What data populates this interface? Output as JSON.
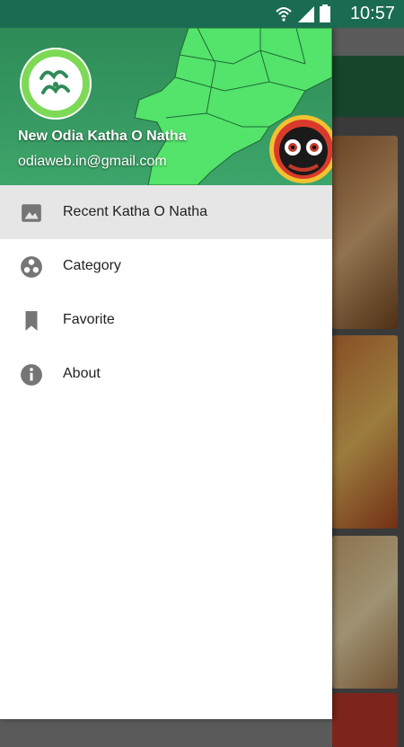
{
  "status_bar": {
    "time": "10:57"
  },
  "drawer": {
    "title": "New Odia Katha O Natha",
    "email": "odiaweb.in@gmail.com",
    "menu": [
      {
        "label": "Recent Katha O Natha",
        "icon": "image-icon",
        "active": true
      },
      {
        "label": "Category",
        "icon": "category-icon",
        "active": false
      },
      {
        "label": "Favorite",
        "icon": "bookmark-icon",
        "active": false
      },
      {
        "label": "About",
        "icon": "info-icon",
        "active": false
      }
    ]
  },
  "colors": {
    "status_bar": "#1b6b52",
    "header_green": "#2e8b57",
    "map_green": "#54e36b",
    "active_item": "#e6e6e6",
    "icon_gray": "#757575"
  }
}
